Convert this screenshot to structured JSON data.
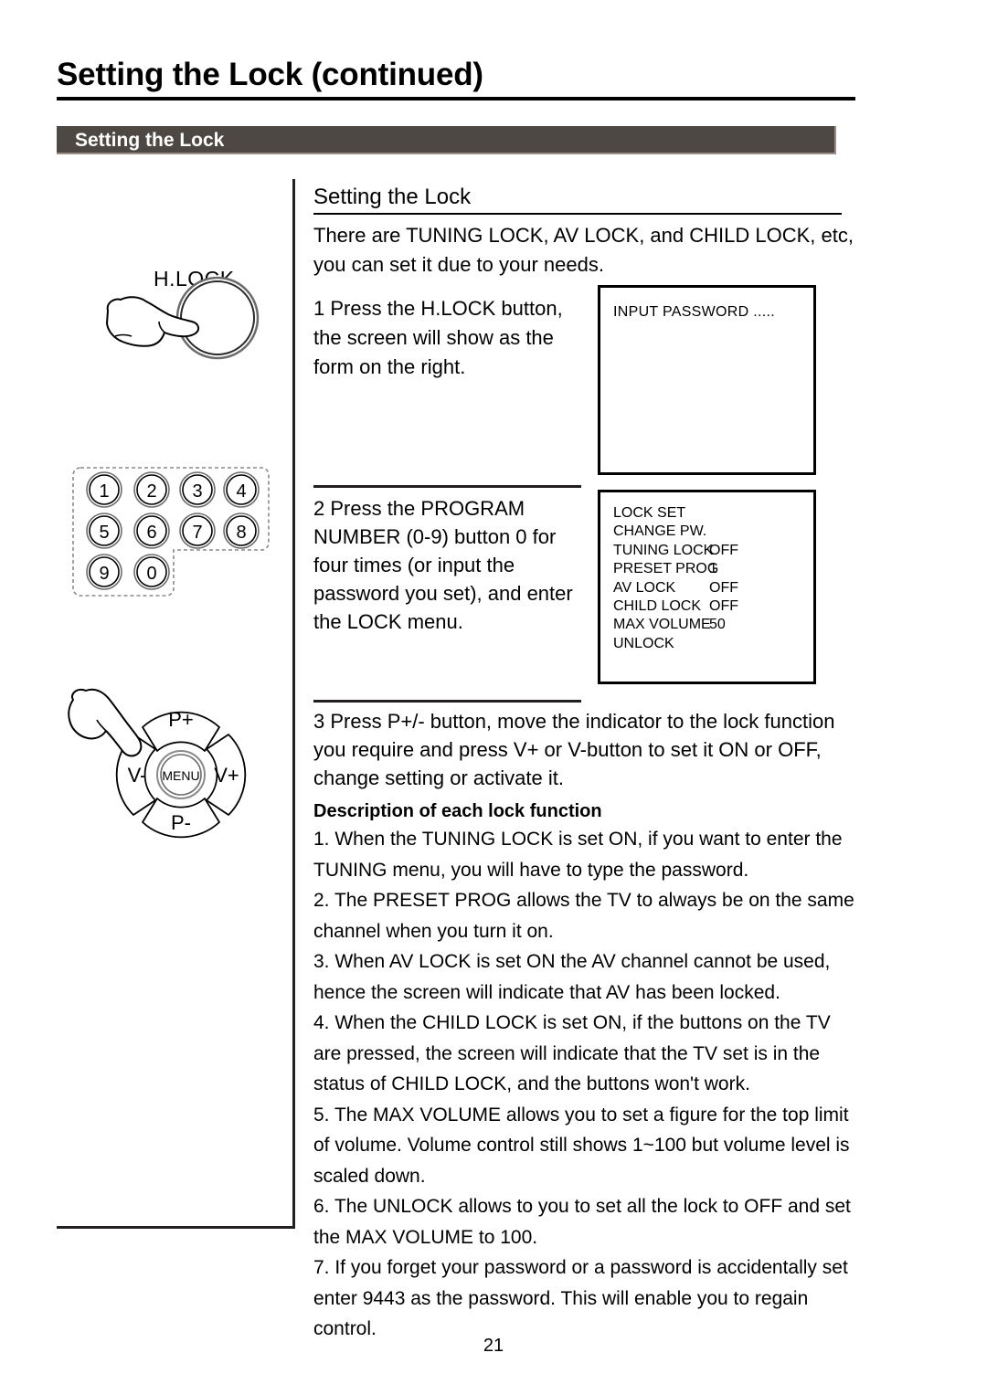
{
  "page": {
    "title": "Setting the Lock (continued)",
    "section_header": "Setting the Lock",
    "number": "21"
  },
  "content": {
    "subtitle": "Setting the Lock",
    "intro": "There are TUNING LOCK, AV LOCK, and CHILD LOCK, etc, you can set it due to your needs.",
    "step1": "1 Press the H.LOCK button, the screen will show as the form on the right.",
    "step2": "2 Press the PROGRAM NUMBER (0-9) button 0 for four times (or input the password you set), and enter the LOCK menu.",
    "step3": "3 Press P+/- button, move the indicator to the lock function you require and press V+ or V-button to set it ON or OFF, change setting or activate it.",
    "description_heading": "Description of each lock function",
    "description_items": [
      "1. When the TUNING LOCK is set ON, if you want to enter the TUNING menu, you will have to type the password.",
      "2. The PRESET PROG allows the TV to always be on the same channel when you turn it on.",
      "3. When AV LOCK is set ON the AV channel cannot be used, hence the screen will indicate that AV has been locked.",
      "4. When the CHILD LOCK is set ON, if the buttons on the TV are pressed, the screen will indicate that the TV set is in the status of CHILD LOCK, and the buttons won't work.",
      "5. The MAX VOLUME allows you to set a figure for the top limit of volume. Volume control still shows 1~100 but volume level is scaled down.",
      "6. The UNLOCK allows to you to set all the lock to OFF and set the MAX VOLUME to 100.",
      "7. If you forget your password or a password is accidentally set enter 9443 as the password. This will enable you to regain control."
    ]
  },
  "osd": {
    "password_screen": {
      "text": "INPUT PASSWORD ....."
    },
    "lock_menu": {
      "rows": [
        {
          "label": "LOCK SET",
          "value": ""
        },
        {
          "label": "CHANGE PW.",
          "value": ""
        },
        {
          "label": "TUNING LOCK",
          "value": "OFF"
        },
        {
          "label": "PRESET PROG",
          "value": "1"
        },
        {
          "label": "AV LOCK",
          "value": "OFF"
        },
        {
          "label": "CHILD LOCK",
          "value": "OFF"
        },
        {
          "label": "MAX VOLUME",
          "value": "50"
        },
        {
          "label": "UNLOCK",
          "value": ""
        }
      ]
    }
  },
  "illustrations": {
    "hlock": {
      "label": "H.LOCK"
    },
    "keypad": {
      "keys": [
        "1",
        "2",
        "3",
        "4",
        "5",
        "6",
        "7",
        "8",
        "9",
        "0"
      ]
    },
    "dpad": {
      "up": "P+",
      "down": "P-",
      "left": "V-",
      "right": "V+",
      "center": "MENU"
    }
  },
  "colors": {
    "header_bar": "#4e4845",
    "header_bar_shadow": "#9b8d88",
    "ink": "#000000"
  }
}
